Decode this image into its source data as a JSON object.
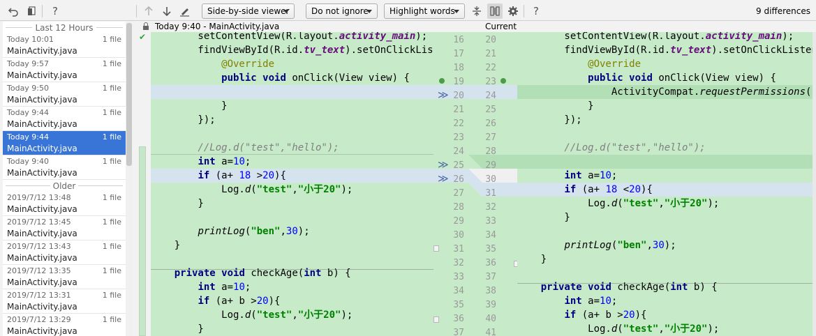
{
  "toolbar": {
    "icons": [
      "undo-icon",
      "compare-icon",
      "help-icon",
      "prev-diff-icon",
      "next-diff-icon",
      "edit-icon",
      "collapse-icon",
      "sync-scroll-icon",
      "settings-icon",
      "help-icon"
    ],
    "viewer_mode": "Side-by-side viewer",
    "whitespace_mode": "Do not ignore",
    "highlight_mode": "Highlight words",
    "help_label": "?",
    "differences": "9 differences"
  },
  "history": {
    "group_recent": "Last 12 Hours",
    "group_older": "Older",
    "recent": [
      {
        "date": "Today 10:01",
        "file": "MainActivity.java",
        "count": "1 file"
      },
      {
        "date": "Today 9:57",
        "file": "MainActivity.java",
        "count": "1 file"
      },
      {
        "date": "Today 9:50",
        "file": "MainActivity.java",
        "count": "1 file"
      },
      {
        "date": "Today 9:44",
        "file": "MainActivity.java",
        "count": "1 file"
      },
      {
        "date": "Today 9:44",
        "file": "MainActivity.java",
        "count": "1 file"
      },
      {
        "date": "Today 9:40",
        "file": "MainActivity.java",
        "count": "1 file"
      }
    ],
    "older": [
      {
        "date": "2019/7/12 13:48",
        "file": "MainActivity.java",
        "count": "1 file"
      },
      {
        "date": "2019/7/12 13:45",
        "file": "MainActivity.java",
        "count": "1 file"
      },
      {
        "date": "2019/7/12 13:43",
        "file": "MainActivity.java",
        "count": "1 file"
      },
      {
        "date": "2019/7/12 13:35",
        "file": "MainActivity.java",
        "count": "1 file"
      },
      {
        "date": "2019/7/12 13:31",
        "file": "MainActivity.java",
        "count": "1 file"
      },
      {
        "date": "2019/7/12 13:29",
        "file": "MainActivity.java",
        "count": "1 file"
      }
    ],
    "selected": "recent.4"
  },
  "editor": {
    "left_title": "Today 9:40 - MainActivity.java",
    "right_title": "Current",
    "left_numbers": [
      "16",
      "17",
      "18",
      "19",
      "20",
      "21",
      "22",
      "23",
      "24",
      "25",
      "26",
      "27",
      "28",
      "29",
      "30",
      "31",
      "32",
      "33",
      "34",
      "35",
      "36",
      "37"
    ],
    "right_numbers": [
      "20",
      "21",
      "22",
      "23",
      "24",
      "25",
      "26",
      "27",
      "28",
      "29",
      "30",
      "31",
      "32",
      "33",
      "34",
      "35",
      "36",
      "37",
      "38",
      "39",
      "40",
      "41"
    ],
    "left_code": [
      "        setContentView(R.layout.activity_main);",
      "        findViewById(R.id.tv_text).setOnClickListener(",
      "            @Override",
      "            public void onClick(View view) {",
      "",
      "            }",
      "        });",
      "",
      "        //Log.d(\"test\",\"hello\");",
      "        int a=10;",
      "        if (a+ 18 >20){",
      "            Log.d(\"test\",\"小于20\");",
      "        }",
      "",
      "        printLog(\"ben\",30);",
      "    }",
      "",
      "    private void checkAge(int b) {",
      "        int a=10;",
      "        if (a+ b >20){",
      "            Log.d(\"test\",\"小于20\");",
      "        }"
    ],
    "right_code": [
      "        setContentView(R.layout.activity_main);",
      "        findViewById(R.id.tv_text).setOnClickListener(",
      "            @Override",
      "            public void onClick(View view) {",
      "                ActivityCompat.requestPermissions(",
      "            }",
      "        });",
      "",
      "        //Log.d(\"test\",\"hello\");",
      "",
      "        int a=10;",
      "        if (a+ 18 <20){",
      "            Log.d(\"test\",\"小于20\");",
      "        }",
      "",
      "        printLog(\"ben\",30);",
      "    }",
      "",
      "    private void checkAge(int b) {",
      "        int a=10;",
      "        if (a+ b >20){",
      "            Log.d(\"test\",\"小于20\");"
    ],
    "colors": {
      "added": "#c7ebc9",
      "modified": "#d5e3ef",
      "inserted": "#b3dfb7",
      "keyword": "#000080",
      "string": "#008000",
      "number": "#0000ff",
      "comment": "#808080"
    }
  }
}
